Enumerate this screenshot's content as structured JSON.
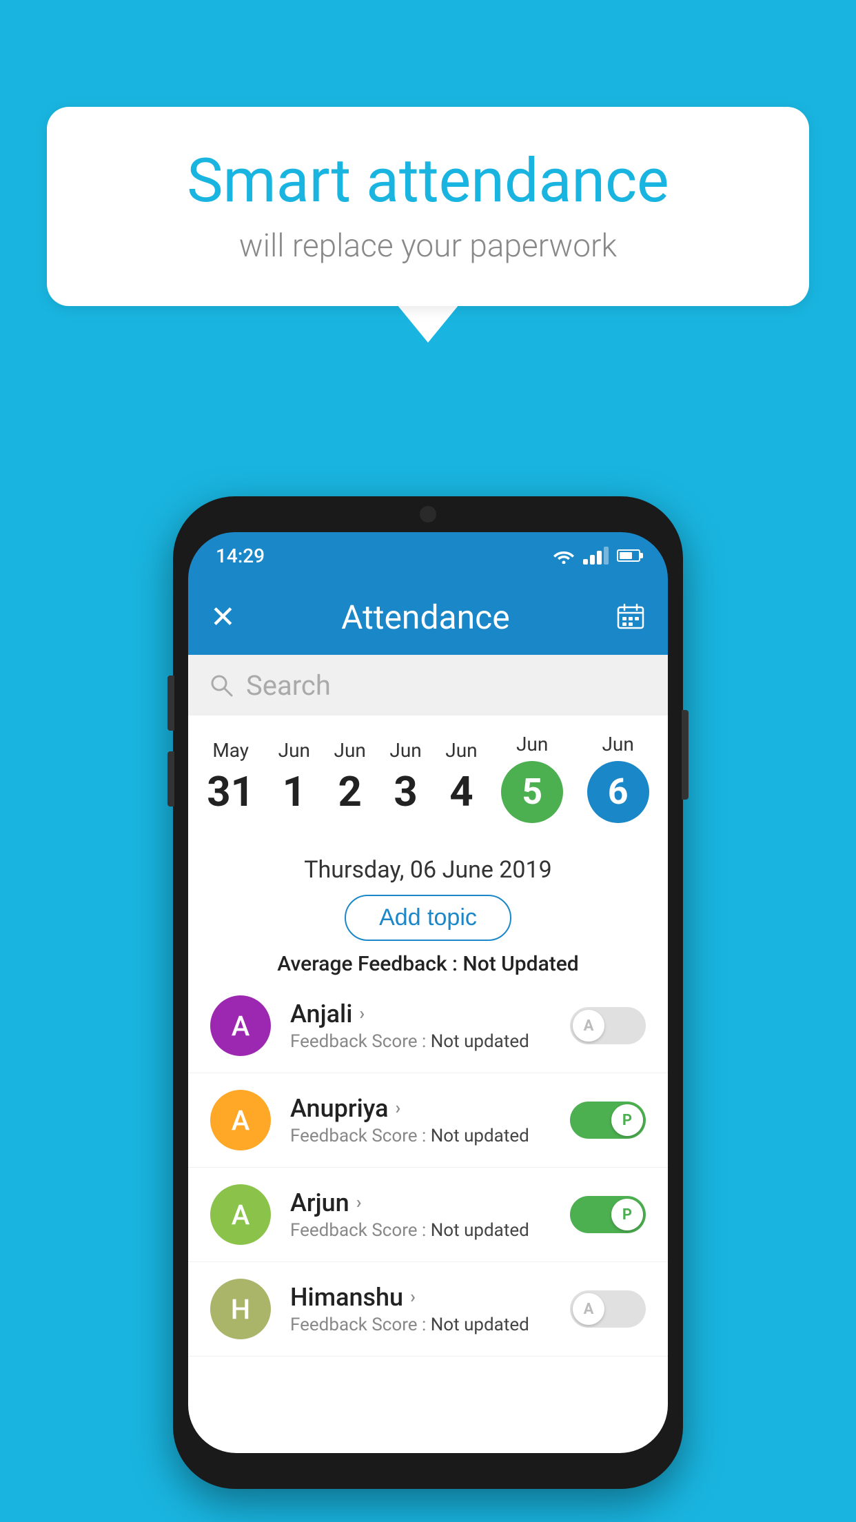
{
  "background_color": "#19b5e0",
  "speech_bubble": {
    "title": "Smart attendance",
    "subtitle": "will replace your paperwork"
  },
  "status_bar": {
    "time": "14:29"
  },
  "app_bar": {
    "title": "Attendance",
    "close_label": "✕"
  },
  "search": {
    "placeholder": "Search"
  },
  "dates": [
    {
      "month": "May",
      "day": "31",
      "selected": false
    },
    {
      "month": "Jun",
      "day": "1",
      "selected": false
    },
    {
      "month": "Jun",
      "day": "2",
      "selected": false
    },
    {
      "month": "Jun",
      "day": "3",
      "selected": false
    },
    {
      "month": "Jun",
      "day": "4",
      "selected": false
    },
    {
      "month": "Jun",
      "day": "5",
      "selected": "green"
    },
    {
      "month": "Jun",
      "day": "6",
      "selected": "blue"
    }
  ],
  "selected_date": "Thursday, 06 June 2019",
  "add_topic_label": "Add topic",
  "avg_feedback_label": "Average Feedback :",
  "avg_feedback_value": "Not Updated",
  "students": [
    {
      "name": "Anjali",
      "avatar_letter": "A",
      "avatar_color": "#9c27b0",
      "feedback_label": "Feedback Score :",
      "feedback_value": "Not updated",
      "toggle_state": "off",
      "toggle_letter": "A"
    },
    {
      "name": "Anupriya",
      "avatar_letter": "A",
      "avatar_color": "#ffa726",
      "feedback_label": "Feedback Score :",
      "feedback_value": "Not updated",
      "toggle_state": "on",
      "toggle_letter": "P"
    },
    {
      "name": "Arjun",
      "avatar_letter": "A",
      "avatar_color": "#8bc34a",
      "feedback_label": "Feedback Score :",
      "feedback_value": "Not updated",
      "toggle_state": "on",
      "toggle_letter": "P"
    },
    {
      "name": "Himanshu",
      "avatar_letter": "H",
      "avatar_color": "#aab56a",
      "feedback_label": "Feedback Score :",
      "feedback_value": "Not updated",
      "toggle_state": "off",
      "toggle_letter": "A"
    }
  ]
}
